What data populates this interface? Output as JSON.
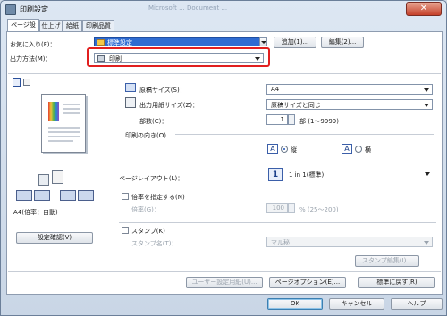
{
  "window": {
    "title": "印刷設定",
    "faded_title": "Microsoft ... Document ...",
    "close": "✕"
  },
  "tabs": [
    "ページ設定",
    "仕上げ",
    "給紙",
    "印刷品質"
  ],
  "favorites": {
    "label": "お気に入り(F)：",
    "value": "標準設定",
    "add": "追加(1)...",
    "edit": "編集(2)..."
  },
  "output": {
    "label": "出力方法(M)：",
    "value": "印刷"
  },
  "paper": {
    "original_label": "原稿サイズ(S)：",
    "original_value": "A4",
    "output_label": "出力用紙サイズ(Z)：",
    "output_value": "原稿サイズと同じ",
    "copies_label": "部数(C)：",
    "copies_value": "1",
    "copies_suffix": "部 (1～9999)"
  },
  "orientation": {
    "label": "印刷の向き(O)",
    "portrait": "縦",
    "landscape": "横"
  },
  "preview": {
    "caption": "A4(倍率：自動)",
    "settings_button": "設定確認(V)"
  },
  "page_layout": {
    "label": "ページレイアウト(L)：",
    "value": "1 in 1(標準)",
    "icon": "1"
  },
  "scale": {
    "checkbox": "倍率を指定する(N)",
    "label": "倍率(G)：",
    "value": "100",
    "suffix": "% (25～200)"
  },
  "stamp": {
    "checkbox": "スタンプ(K)",
    "label": "スタンプ名(T)：",
    "value": "マル秘",
    "edit": "スタンプ編集(I)..."
  },
  "actions": {
    "user_paper": "ユーザー設定用紙(U)...",
    "page_options": "ページオプション(E)...",
    "defaults": "標準に戻す(R)"
  },
  "footer": {
    "ok": "OK",
    "cancel": "キャンセル",
    "help": "ヘルプ"
  }
}
